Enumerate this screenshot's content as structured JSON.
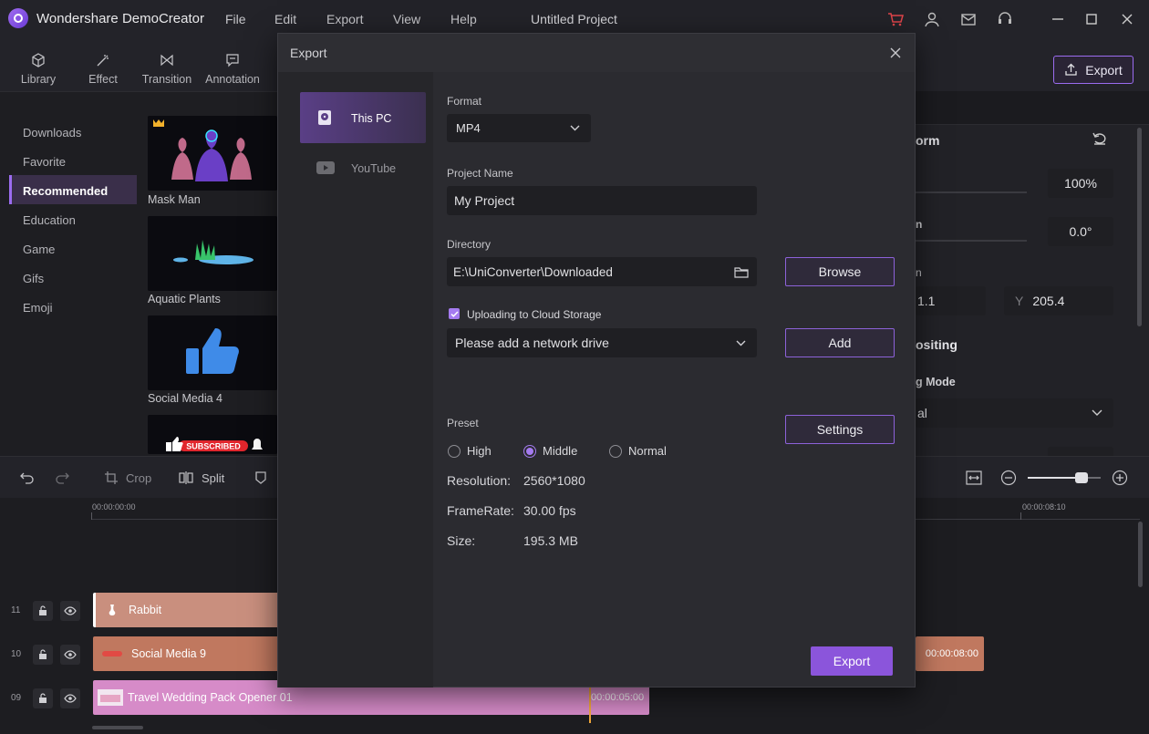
{
  "app": {
    "title": "Wondershare DemoCreator",
    "menu": [
      "File",
      "Edit",
      "Export",
      "View",
      "Help"
    ],
    "project_title": "Untitled Project"
  },
  "toolbar": {
    "tools": [
      {
        "label": "Library",
        "icon": "cube-icon"
      },
      {
        "label": "Effect",
        "icon": "magic-wand-icon"
      },
      {
        "label": "Transition",
        "icon": "transition-icon"
      },
      {
        "label": "Annotation",
        "icon": "annotation-icon"
      }
    ],
    "export_label": "Export"
  },
  "library": {
    "categories": [
      "Downloads",
      "Favorite",
      "Recommended",
      "Education",
      "Game",
      "Gifs",
      "Emoji"
    ],
    "active_category": "Recommended",
    "items": [
      "Mask Man",
      "Aquatic Plants",
      "Social Media 4"
    ],
    "partial_badge": "SUBSCRIBED"
  },
  "properties": {
    "transform_partial": "orm",
    "scale_value": "100%",
    "rotation_partial": "n",
    "rotation_value": "0.0°",
    "position_partial": "n",
    "x_value_partial": "1.1",
    "y_label": "Y",
    "y_value": "205.4",
    "compositing_partial": "ositing",
    "blending_partial": "g Mode",
    "blending_value_partial": "al"
  },
  "timeline_toolbar": {
    "crop_label": "Crop",
    "split_label": "Split"
  },
  "timeline": {
    "ruler_start": "00:00:00:00",
    "ruler_end": "00:00:08:10",
    "tracks": [
      {
        "number": "11",
        "clip": "Rabbit",
        "color": "#c98f7e"
      },
      {
        "number": "10",
        "clip": "Social Media 9",
        "color": "#c0785f",
        "end_time": "00:00:08:00"
      },
      {
        "number": "09",
        "clip": "Travel Wedding Pack Opener 01",
        "color": "#d68bc8",
        "end_time": "00:00:05:00"
      }
    ]
  },
  "export_dialog": {
    "title": "Export",
    "targets": [
      {
        "label": "This PC",
        "icon": "hard-drive-icon"
      },
      {
        "label": "YouTube",
        "icon": "youtube-icon"
      }
    ],
    "format_label": "Format",
    "format_value": "MP4",
    "project_name_label": "Project Name",
    "project_name_value": "My Project",
    "directory_label": "Directory",
    "directory_value": "E:\\UniConverter\\Downloaded",
    "browse_label": "Browse",
    "cloud_label": "Uploading to Cloud Storage",
    "cloud_checked": true,
    "network_drive_placeholder": "Please add a network drive",
    "add_label": "Add",
    "preset_label": "Preset",
    "presets": [
      "High",
      "Middle",
      "Normal"
    ],
    "preset_selected": "Middle",
    "settings_label": "Settings",
    "resolution_label": "Resolution:",
    "resolution_value": "2560*1080",
    "framerate_label": "FrameRate:",
    "framerate_value": "30.00 fps",
    "size_label": "Size:",
    "size_value": "195.3 MB",
    "export_label": "Export"
  },
  "colors": {
    "accent": "#9b6cf0",
    "export_button": "#8b55db"
  }
}
